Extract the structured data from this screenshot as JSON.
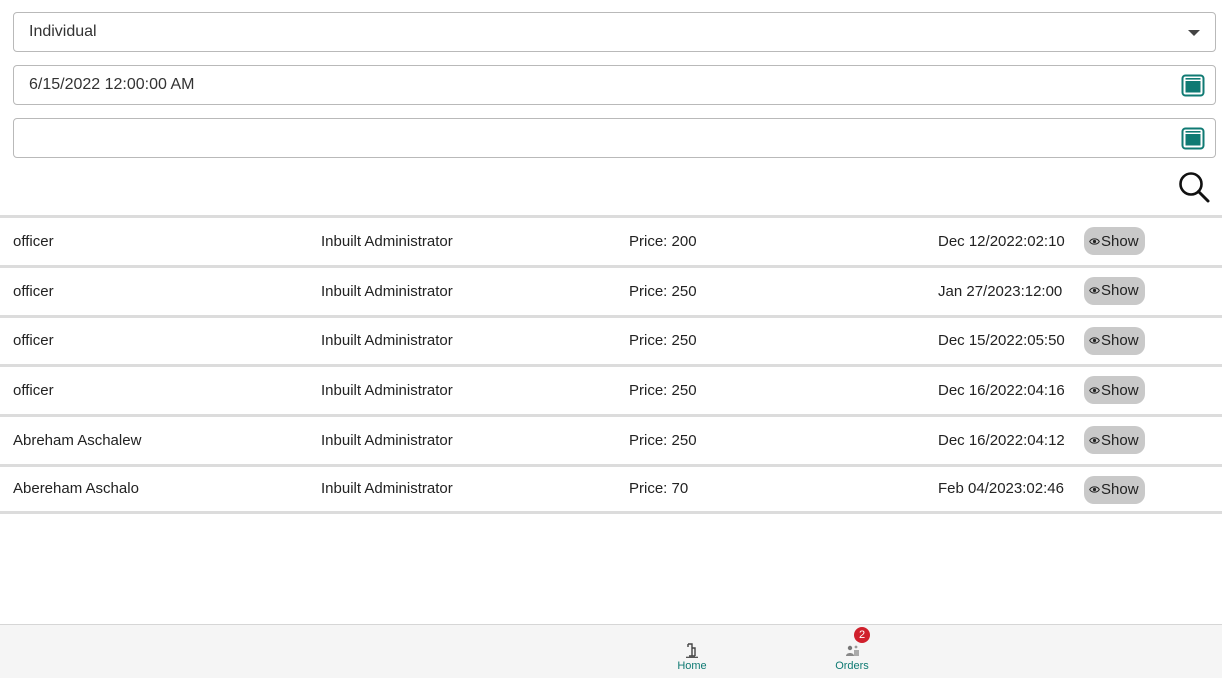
{
  "filters": {
    "type_value": "Individual",
    "start_date_value": "6/15/2022 12:00:00 AM",
    "end_date_value": ""
  },
  "records": [
    {
      "name": "officer",
      "admin": "Inbuilt Administrator",
      "price": "Price: 200",
      "date": "Dec 12/2022:02:10",
      "action": "Show"
    },
    {
      "name": "officer",
      "admin": "Inbuilt Administrator",
      "price": "Price: 250",
      "date": "Jan 27/2023:12:00",
      "action": "Show"
    },
    {
      "name": "officer",
      "admin": "Inbuilt Administrator",
      "price": "Price: 250",
      "date": "Dec 15/2022:05:50",
      "action": "Show"
    },
    {
      "name": "officer",
      "admin": "Inbuilt Administrator",
      "price": "Price: 250",
      "date": "Dec 16/2022:04:16",
      "action": "Show"
    },
    {
      "name": "Abreham Aschalew",
      "admin": "Inbuilt Administrator",
      "price": "Price: 250",
      "date": "Dec 16/2022:04:12",
      "action": "Show"
    },
    {
      "name": "Abereham Aschalo",
      "admin": "Inbuilt Administrator",
      "price": "Price: 70",
      "date": "Feb 04/2023:02:46",
      "action": "Show"
    }
  ],
  "bottom_nav": {
    "home_label": "Home",
    "orders_label": "Orders",
    "orders_badge": "2"
  },
  "colors": {
    "accent": "#0f7a73",
    "badge": "#d0202c",
    "show_button_bg": "#c9c9c9"
  },
  "icons": {
    "type_dropdown": "chevron-down-icon",
    "date_picker": "calendar-icon",
    "search": "search-icon",
    "show": "eye-icon",
    "home": "home-icon",
    "orders": "orders-icon"
  }
}
